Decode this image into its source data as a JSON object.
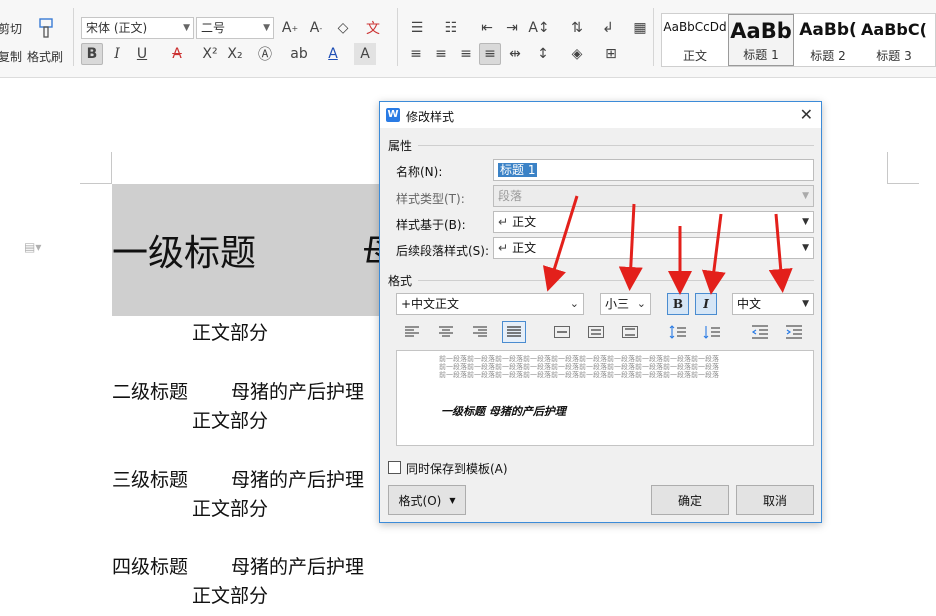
{
  "ribbon": {
    "clipboard": {
      "cut_label": "剪切",
      "copy_label": "复制",
      "format_painter_label": "格式刷"
    },
    "font": {
      "name": "宋体 (正文)",
      "size": "二号"
    },
    "styles": [
      {
        "preview": "AaBbCcDd",
        "name": "正文"
      },
      {
        "preview": "AaBb",
        "name": "标题 1"
      },
      {
        "preview": "AaBb(",
        "name": "标题 2"
      },
      {
        "preview": "AaBbC(",
        "name": "标题 3"
      }
    ]
  },
  "document": {
    "heading1": "一级标题",
    "heading1_tail": "母",
    "body": "正文部分",
    "rows": [
      {
        "level": "二级标题",
        "title": "母猪的产后护理",
        "body": "正文部分"
      },
      {
        "level": "三级标题",
        "title": "母猪的产后护理",
        "body": "正文部分"
      },
      {
        "level": "四级标题",
        "title": "母猪的产后护理",
        "body": "正文部分"
      }
    ]
  },
  "dialog": {
    "title": "修改样式",
    "properties_section": "属性",
    "name_label": "名称(N):",
    "name_value": "标题 1",
    "style_type_label": "样式类型(T):",
    "style_type_value": "段落",
    "based_on_label": "样式基于(B):",
    "based_on_value": "正文",
    "following_label": "后续段落样式(S):",
    "following_value": "正文",
    "format_section": "格式",
    "font_value": "+中文正文",
    "size_value": "小三",
    "bold_label": "B",
    "italic_label": "I",
    "script_value": "中文",
    "preview_prev_para": "前一段落前一段落前一段落前一段落前一段落前一段落前一段落前一段落前一段落前一段落",
    "preview_sample": "一级标题      母猪的产后护理",
    "save_to_template_label": "同时保存到模板(A)",
    "format_button": "格式(O)",
    "ok_button": "确定",
    "cancel_button": "取消"
  },
  "colors": {
    "accent": "#3b82c6",
    "arrow": "#e3201b",
    "heading_shade": "#cfcfcf"
  }
}
